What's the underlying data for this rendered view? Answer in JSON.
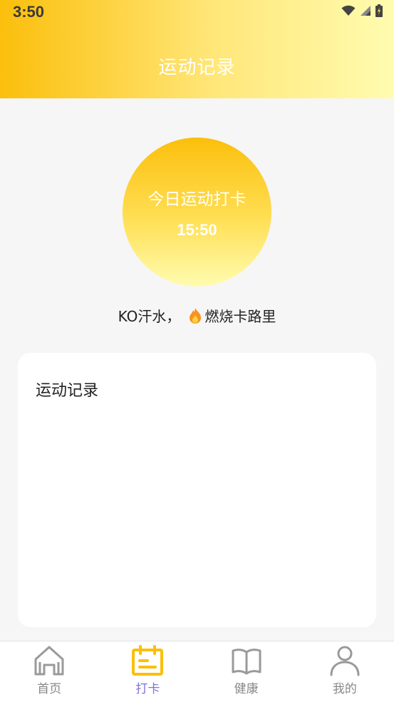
{
  "status_bar": {
    "time": "3:50",
    "icons": [
      "wifi-icon",
      "signal-icon",
      "battery-icon"
    ]
  },
  "header": {
    "title": "运动记录"
  },
  "checkin": {
    "label": "今日运动打卡",
    "time": "15:50"
  },
  "slogan": {
    "prefix": "KO汗水，",
    "icon": "fire-icon",
    "suffix": "燃烧卡路里"
  },
  "records": {
    "title": "运动记录"
  },
  "tabs": [
    {
      "label": "首页",
      "icon": "home-icon",
      "active": false
    },
    {
      "label": "打卡",
      "icon": "calendar-icon",
      "active": true
    },
    {
      "label": "健康",
      "icon": "book-icon",
      "active": false
    },
    {
      "label": "我的",
      "icon": "profile-icon",
      "active": false
    }
  ],
  "colors": {
    "brand_yellow": "#fbbf0c",
    "light_yellow": "#fffcb0",
    "active_tab_label": "#7d74e0",
    "inactive_tab": "#888888"
  }
}
